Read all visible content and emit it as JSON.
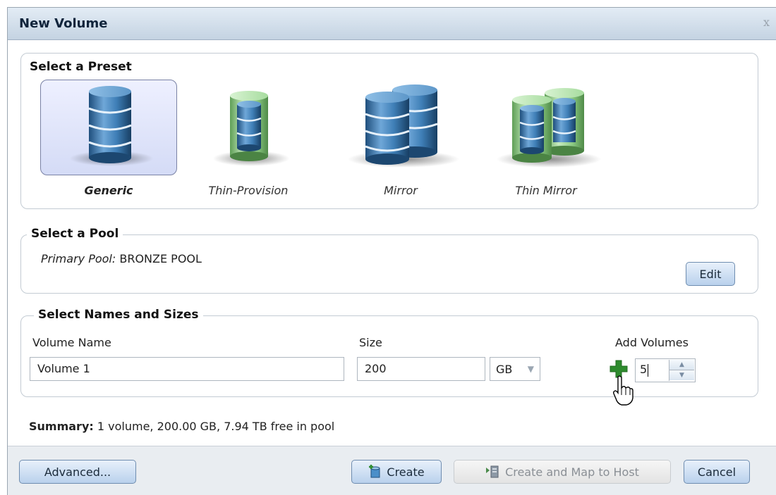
{
  "dialog": {
    "title": "New Volume",
    "close_label": "x"
  },
  "presets": {
    "legend": "Select a Preset",
    "items": [
      {
        "label": "Generic",
        "icon": "database-icon",
        "selected": true
      },
      {
        "label": "Thin-Provision",
        "icon": "thin-database-icon",
        "selected": false
      },
      {
        "label": "Mirror",
        "icon": "mirror-database-icon",
        "selected": false
      },
      {
        "label": "Thin Mirror",
        "icon": "thin-mirror-database-icon",
        "selected": false
      }
    ]
  },
  "pool": {
    "legend": "Select a Pool",
    "primary_label": "Primary Pool:",
    "primary_value": "BRONZE POOL",
    "edit_label": "Edit"
  },
  "names": {
    "legend": "Select Names and Sizes",
    "volume_name_label": "Volume Name",
    "volume_name_value": "Volume 1",
    "size_label": "Size",
    "size_value": "200",
    "unit_value": "GB",
    "add_volumes_label": "Add Volumes",
    "add_volumes_value": "5"
  },
  "summary": {
    "label": "Summary:",
    "text": "1 volume, 200.00 GB, 7.94 TB free in pool"
  },
  "footer": {
    "advanced_label": "Advanced...",
    "create_label": "Create",
    "create_map_label": "Create and Map to Host",
    "cancel_label": "Cancel"
  },
  "colors": {
    "blue_disk": "#3a77ad",
    "green_disk": "#8ccf82",
    "accent": "#2e8b2e"
  }
}
